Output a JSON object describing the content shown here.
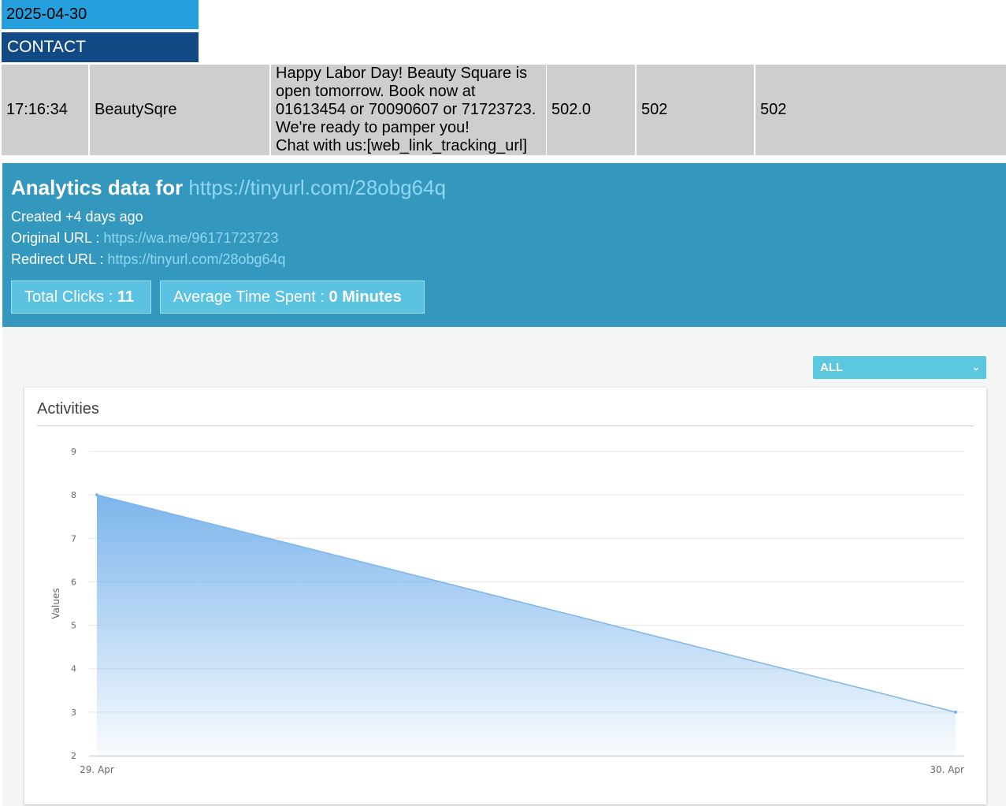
{
  "header": {
    "date": "2025-04-30",
    "contact_label": "CONTACT"
  },
  "row": {
    "time": "17:16:34",
    "sender": "BeautySqre",
    "message_lines": [
      "Happy Labor Day! Beauty Square is",
      "open tomorrow. Book now at",
      "01613454 or 70090607 or 71723723.",
      "We're ready to pamper you!",
      "Chat with us:[web_link_tracking_url]"
    ],
    "col4": "502.0",
    "col5": "502",
    "col6": "502"
  },
  "analytics": {
    "title_prefix": "Analytics data for",
    "title_url": "https://tinyurl.com/28obg64q",
    "created": "Created +4 days ago",
    "original_label": "Original URL :",
    "original_url": "https://wa.me/96171723723",
    "redirect_label": "Redirect URL :",
    "redirect_url": "https://tinyurl.com/28obg64q",
    "total_clicks_label": "Total Clicks :",
    "total_clicks_value": "11",
    "avg_time_label": "Average Time Spent :",
    "avg_time_value": "0 Minutes"
  },
  "filter": {
    "selected": "ALL"
  },
  "card": {
    "title": "Activities"
  },
  "colors": {
    "date_bg": "#25a0dd",
    "contact_bg": "#124a85",
    "analytics_bg": "#3497bd",
    "series_line": "#7cb5ec"
  },
  "chart_data": {
    "type": "area",
    "categories": [
      "29. Apr",
      "30. Apr"
    ],
    "values": [
      8,
      3
    ],
    "ylabel": "Values",
    "ylim": [
      2,
      9
    ],
    "yticks": [
      2,
      3,
      4,
      5,
      6,
      7,
      8,
      9
    ],
    "grid": true
  }
}
